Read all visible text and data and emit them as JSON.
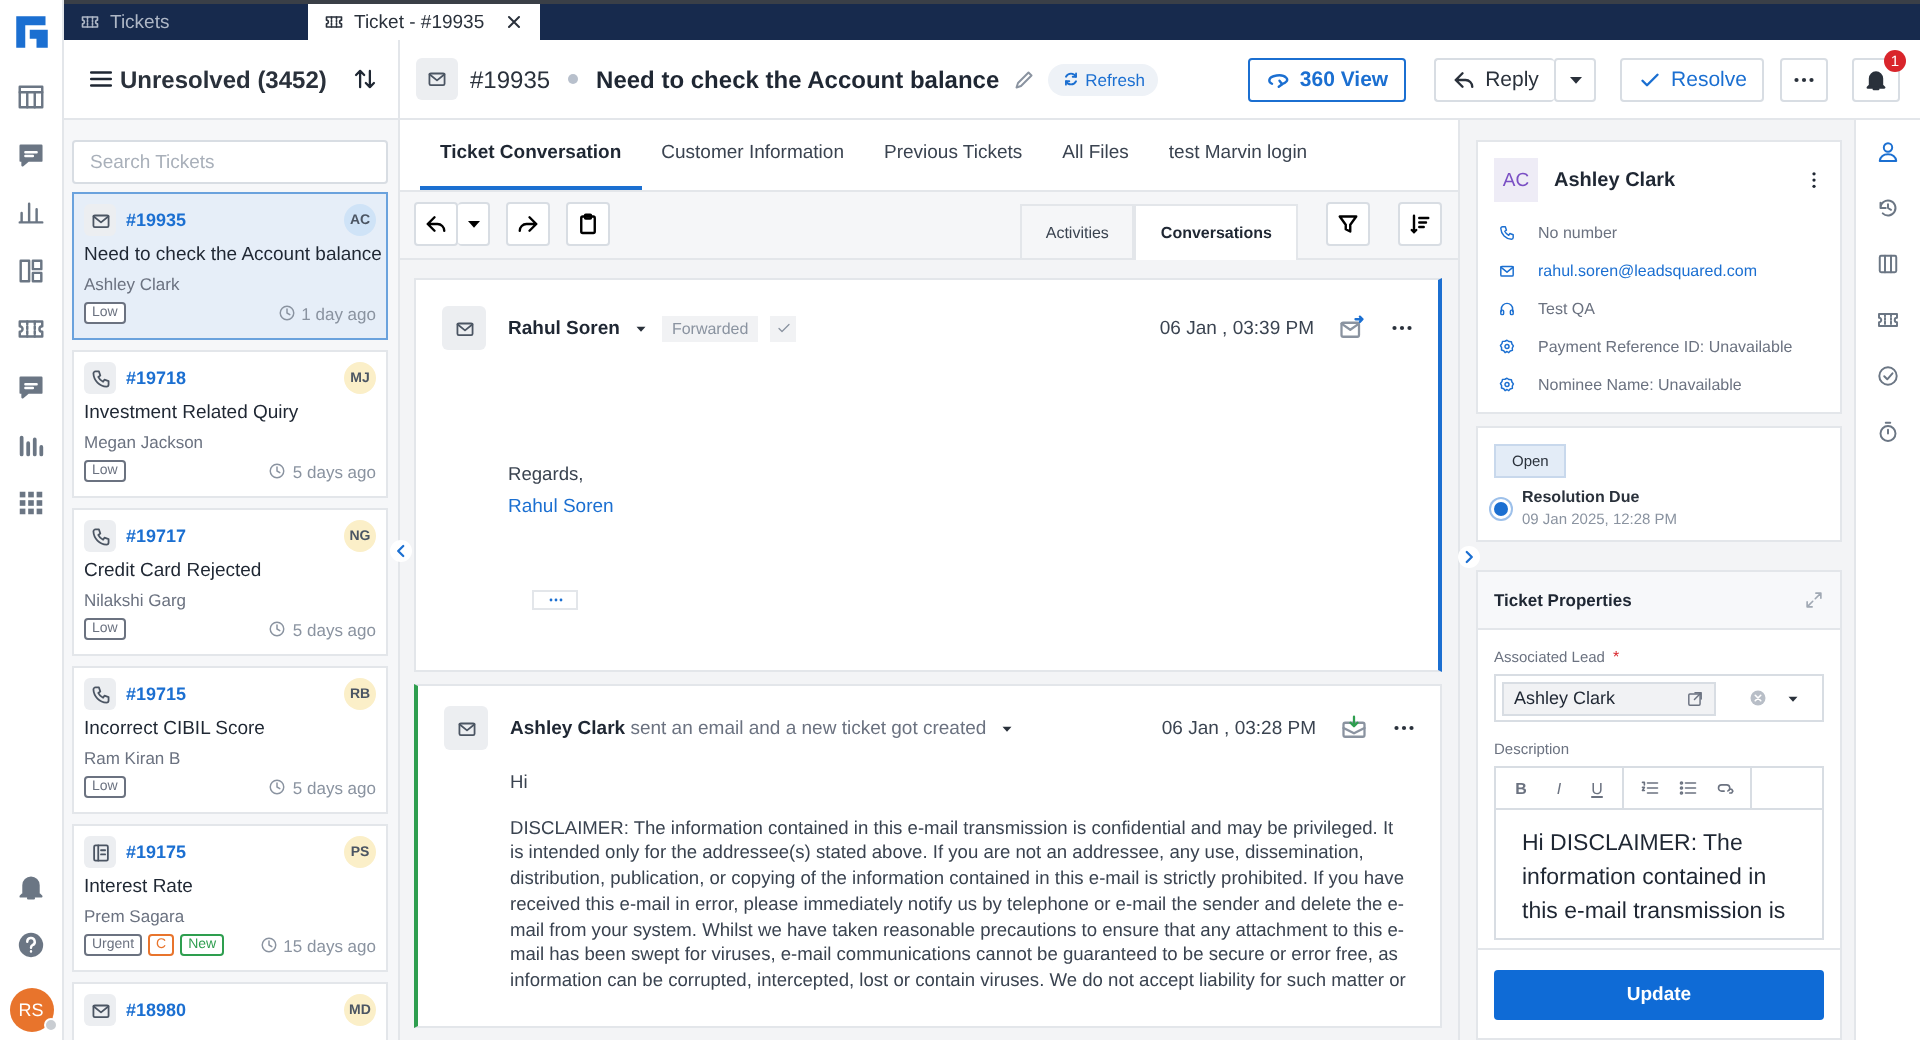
{
  "app_tabs": [
    {
      "label": "Tickets",
      "selected": false,
      "closable": false
    },
    {
      "label": "Ticket - #19935",
      "selected": true,
      "closable": true
    }
  ],
  "user": {
    "initials": "RS"
  },
  "list_header": {
    "title": "Unresolved (3452)"
  },
  "search": {
    "placeholder": "Search Tickets"
  },
  "tickets": [
    {
      "kind": "email",
      "number": "#19935",
      "initials": "AC",
      "color": "#cfe3f7",
      "subject": "Need to check the Account balance",
      "contact": "Ashley Clark",
      "tags": [
        {
          "label": "Low",
          "color": "#6b7280"
        }
      ],
      "age": "1 day ago",
      "selected": true
    },
    {
      "kind": "phone",
      "number": "#19718",
      "initials": "MJ",
      "color": "#fbefc8",
      "subject": "Investment Related Quiry",
      "contact": "Megan Jackson",
      "tags": [
        {
          "label": "Low",
          "color": "#6b7280"
        }
      ],
      "age": "5 days ago",
      "selected": false
    },
    {
      "kind": "phone",
      "number": "#19717",
      "initials": "NG",
      "color": "#fbefc8",
      "subject": "Credit Card Rejected",
      "contact": "Nilakshi Garg",
      "tags": [
        {
          "label": "Low",
          "color": "#6b7280"
        }
      ],
      "age": "5 days ago",
      "selected": false
    },
    {
      "kind": "phone",
      "number": "#19715",
      "initials": "RB",
      "color": "#fbefc8",
      "subject": "Incorrect CIBIL Score",
      "contact": "Ram Kiran B",
      "tags": [
        {
          "label": "Low",
          "color": "#6b7280"
        }
      ],
      "age": "5 days ago",
      "selected": false
    },
    {
      "kind": "form",
      "number": "#19175",
      "initials": "PS",
      "color": "#fbefc8",
      "subject": "Interest Rate",
      "contact": "Prem Sagara",
      "tags": [
        {
          "label": "Urgent",
          "color": "#6b7280"
        },
        {
          "label": "C",
          "color": "#e8742c"
        },
        {
          "label": "New",
          "color": "#2e9e4f"
        }
      ],
      "age": "15 days ago",
      "selected": false
    },
    {
      "kind": "email",
      "number": "#18980",
      "initials": "MD",
      "color": "#fbefc8",
      "selected": false
    }
  ],
  "ticket": {
    "kind": "email",
    "number": "#19935",
    "subject": "Need to check the Account balance",
    "refresh": "Refresh"
  },
  "actions": {
    "view360": "360 View",
    "reply": "Reply",
    "resolve": "Resolve"
  },
  "notifications": {
    "count": "1"
  },
  "tabs": [
    {
      "label": "Ticket Conversation",
      "selected": true
    },
    {
      "label": "Customer Information",
      "selected": false
    },
    {
      "label": "Previous Tickets",
      "selected": false
    },
    {
      "label": "All Files",
      "selected": false
    },
    {
      "label": "test Marvin login",
      "selected": false
    }
  ],
  "view_toggle": [
    {
      "label": "Activities",
      "selected": false
    },
    {
      "label": "Conversations",
      "selected": true
    }
  ],
  "messages": [
    {
      "kind": "forwarded",
      "sender": "Rahul Soren",
      "status": "Forwarded",
      "time": "06 Jan , 03:39 PM",
      "truncated": true,
      "body": [
        {
          "kind": "text",
          "text": "Regards,"
        },
        {
          "kind": "link",
          "text": "Rahul Soren"
        }
      ]
    },
    {
      "kind": "incoming",
      "sender": "Ashley Clark",
      "action": "sent an email and a new ticket got created",
      "time": "06 Jan , 03:28 PM",
      "truncated": false,
      "body": [
        {
          "kind": "text",
          "text": "Hi"
        },
        {
          "kind": "text",
          "text": "DISCLAIMER: The information contained in this e-mail transmission is confidential and may be privileged. It is intended only for the addressee(s) stated above. If you are not an addressee, any use, dissemination, distribution, publication, or copying of the information contained in this e-mail is strictly prohibited. If you have received this e-mail in error, please immediately notify us by telephone or e-mail the sender and delete the e-mail from your system. Whilst we have taken reasonable precautions to ensure that any attachment to this e-mail has been swept for viruses, e-mail communications cannot be guaranteed to be secure or error free, as information can be corrupted, intercepted, lost or contain viruses. We do not accept liability for such matter or"
        }
      ]
    }
  ],
  "contact": {
    "initials": "AC",
    "name": "Ashley Clark",
    "details": [
      {
        "kind": "phone",
        "text": "No number"
      },
      {
        "kind": "email",
        "text": "rahul.soren@leadsquared.com"
      },
      {
        "kind": "team",
        "text": "Test QA"
      },
      {
        "kind": "field",
        "text": "Payment Reference ID: Unavailable"
      },
      {
        "kind": "field",
        "text": "Nominee Name: Unavailable"
      }
    ]
  },
  "status": {
    "label": "Open",
    "due_label": "Resolution Due",
    "due": "09 Jan 2025, 12:28 PM"
  },
  "properties": {
    "title": "Ticket Properties",
    "lead_label": "Associated Lead",
    "required_mark": "*",
    "lead": "Ashley Clark",
    "description_label": "Description",
    "editor_buttons": [
      "B",
      "I",
      "U"
    ],
    "description": "Hi DISCLAIMER: The information contained in this e-mail transmission is",
    "submit": "Update"
  },
  "right_rail": [
    {
      "kind": "person",
      "selected": true
    },
    {
      "kind": "history",
      "selected": false
    },
    {
      "kind": "columns",
      "selected": false
    },
    {
      "kind": "ticket",
      "selected": false
    },
    {
      "kind": "check",
      "selected": false
    },
    {
      "kind": "timer",
      "selected": false
    }
  ]
}
